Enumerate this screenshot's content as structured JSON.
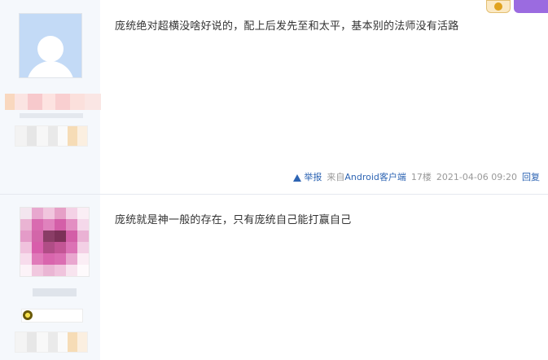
{
  "posts": [
    {
      "content": "庞统绝对超横没啥好说的，配上后发先至和太平，基本别的法师没有活路",
      "footer": {
        "report_label": "举报",
        "source_prefix": "来自",
        "source_link": "Android客户端",
        "floor": "17楼",
        "time": "2021-04-06 09:20",
        "reply_label": "回复"
      }
    },
    {
      "content": "庞统就是神一般的存在，只有庞统自己能打赢自己"
    }
  ],
  "colors": {
    "link": "#2d64b3",
    "meta": "#999999",
    "sidebar": "#f5f8fc"
  },
  "icons": [
    "warning-triangle-icon",
    "default-avatar-icon",
    "level-badge-icon"
  ]
}
